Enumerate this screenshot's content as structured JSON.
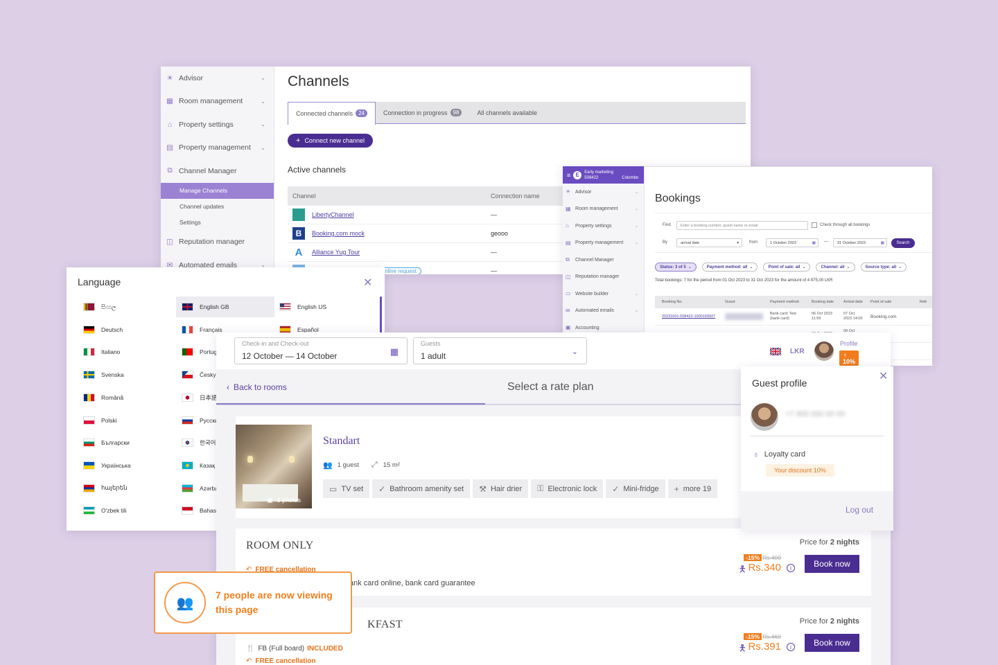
{
  "channels": {
    "title": "Channels",
    "sidebar": [
      {
        "label": "Advisor",
        "icon": "bulb-icon"
      },
      {
        "label": "Room management",
        "icon": "calendar-icon"
      },
      {
        "label": "Property settings",
        "icon": "home-icon"
      },
      {
        "label": "Property management",
        "icon": "clipboard-icon"
      },
      {
        "label": "Channel Manager",
        "icon": "hierarchy-icon"
      }
    ],
    "sidebar_sub": [
      "Manage Channels",
      "Channel updates",
      "Settings"
    ],
    "sidebar_tail": [
      {
        "label": "Reputation manager",
        "icon": "chat-icon"
      },
      {
        "label": "Automated emails",
        "icon": "mail-icon"
      }
    ],
    "tabs": [
      {
        "label": "Connected channels",
        "count": "24"
      },
      {
        "label": "Connection in progress",
        "count": "98"
      },
      {
        "label": "All channels available",
        "count": ""
      }
    ],
    "connect_btn": "Connect new channel",
    "active_title": "Active channels",
    "table_headers": [
      "Channel",
      "Connection name"
    ],
    "rows": [
      {
        "name": "LibertyChannel",
        "conn": "—",
        "logo_color": "#2a9d8f",
        "logo_text": ""
      },
      {
        "name": "Booking.com mock",
        "conn": "gеооо",
        "logo_color": "#1f3f8c",
        "logo_text": "B"
      },
      {
        "name": "Alliance Yug Tour",
        "conn": "—",
        "logo_color": "#ffffff",
        "logo_text": "A"
      },
      {
        "name": "",
        "conn": "—",
        "badge": "Online request",
        "logo_color": "#ffffff",
        "logo_text": ""
      },
      {
        "name": "",
        "conn": "—",
        "logo_color": "#ffffff",
        "logo_text": ""
      },
      {
        "name": "",
        "conn": "—",
        "logo_color": "#ffffff",
        "logo_text": ""
      }
    ]
  },
  "bookings": {
    "title": "Bookings",
    "top_label": "Early marketing",
    "top_sub": "508422",
    "top_city": "Colombo",
    "sidebar": [
      {
        "label": "Advisor",
        "icon": "bulb-icon"
      },
      {
        "label": "Room management",
        "icon": "calendar-icon"
      },
      {
        "label": "Property settings",
        "icon": "home-icon"
      },
      {
        "label": "Property management",
        "icon": "clipboard-icon"
      },
      {
        "label": "Channel Manager",
        "icon": "hierarchy-icon"
      },
      {
        "label": "Reputation manager",
        "icon": "chat-icon"
      },
      {
        "label": "Website builder",
        "icon": "monitor-icon"
      },
      {
        "label": "Automated emails",
        "icon": "mail-icon"
      },
      {
        "label": "Accounting",
        "icon": "wallet-icon"
      }
    ],
    "find_label": "Find",
    "find_placeholder": "Enter a booking number, guest name or email",
    "check_all": "Check through all bookings",
    "by_label": "By",
    "by_value": "arrival date",
    "from_label": "from",
    "from_date": "1 October 2023",
    "to_date": "31 October 2023",
    "search_btn": "Search",
    "chips": [
      {
        "label": "Status: 3 of 5"
      },
      {
        "label": "Payment method: all"
      },
      {
        "label": "Point of sale: all"
      },
      {
        "label": "Channel: all"
      },
      {
        "label": "Source type: all"
      }
    ],
    "total_text": "Total bookings: 7 for the period from 01 Oct 2023 to 31 Oct 2023 for the amount of 4 875,00 LKR",
    "table_headers": [
      "Booking No.",
      "Guest",
      "Payment method",
      "Booking date",
      "Arrival date",
      "Point of sale",
      "Refe"
    ],
    "rows": [
      {
        "no": "20231001-508422-1000169927",
        "guest": "",
        "payment": "Bank card: Test (bank card)",
        "bdate": "06 Oct 2023 11:59",
        "adate": "07 Oct 2023 14:00",
        "pos": "Booking.com"
      },
      {
        "no": "",
        "guest": "",
        "payment": "",
        "bdate": "09 Oct 2023",
        "adate": "09 Oct 2023",
        "pos": "g.com"
      },
      {
        "no": "",
        "guest": "",
        "payment": "",
        "bdate": "",
        "adate": "",
        "pos": "g.com"
      }
    ]
  },
  "language": {
    "title": "Language",
    "col1": [
      {
        "label": "සිංහල",
        "flag": "lk"
      },
      {
        "label": "Deutsch",
        "flag": "de"
      },
      {
        "label": "Italiano",
        "flag": "it"
      },
      {
        "label": "Svenska",
        "flag": "se"
      },
      {
        "label": "Română",
        "flag": "ro"
      },
      {
        "label": "Polski",
        "flag": "pl"
      },
      {
        "label": "Български",
        "flag": "bg"
      },
      {
        "label": "Українська",
        "flag": "ua"
      },
      {
        "label": "հայերեն",
        "flag": "am"
      },
      {
        "label": "O'zbek tili",
        "flag": "uz"
      }
    ],
    "col2": [
      {
        "label": "English GB",
        "flag": "gb"
      },
      {
        "label": "Français",
        "flag": "fr"
      },
      {
        "label": "Portug",
        "flag": "pt"
      },
      {
        "label": "Česky",
        "flag": "cz"
      },
      {
        "label": "日本語",
        "flag": "jp"
      },
      {
        "label": "Русски",
        "flag": "ru"
      },
      {
        "label": "한국어",
        "flag": "kr"
      },
      {
        "label": "Казақ",
        "flag": "kz"
      },
      {
        "label": "Azərba",
        "flag": "az"
      },
      {
        "label": "Bahasa",
        "flag": "id"
      }
    ],
    "col3": [
      {
        "label": "English US",
        "flag": "us"
      },
      {
        "label": "Español",
        "flag": "es"
      }
    ]
  },
  "engine": {
    "dates_label": "Check-in and Check-out",
    "dates_value": "12 October — 14 October",
    "guests_label": "Guests",
    "guests_value": "1 adult",
    "currency": "LKR",
    "profile_label": "Profile",
    "profile_discount": "10%",
    "back_label": "Back to rooms",
    "step_title": "Select a rate plan",
    "room": {
      "name": "Standart",
      "photos": "3 photos",
      "guests": "1 guest",
      "area": "15 m²",
      "amenities": [
        {
          "label": "TV set",
          "icon": "tv-icon"
        },
        {
          "label": "Bathroom amenity set",
          "icon": "check-circle-icon"
        },
        {
          "label": "Hair drier",
          "icon": "hairdryer-icon"
        },
        {
          "label": "Electronic lock",
          "icon": "key-icon"
        },
        {
          "label": "Mini-fridge",
          "icon": "check-circle-icon"
        },
        {
          "label": "more 19",
          "icon": "plus-icon"
        }
      ]
    },
    "plans": [
      {
        "name": "ROOM ONLY",
        "price_for": "Price for",
        "nights": "2 nights",
        "discount": "-15%",
        "old_price": "Rs.400",
        "new_price": "Rs.340",
        "book": "Book now",
        "line1_text": "FREE cancellation",
        "line2_text": "ank card online, bank card guarantee"
      },
      {
        "name": "KFAST",
        "price_for": "Price for",
        "nights": "2 nights",
        "discount": "-15%",
        "old_price": "Rs.460",
        "new_price": "Rs.391",
        "book": "Book now",
        "line1_text": "FB (Full board)",
        "line1_suffix": "INCLUDED",
        "line2_text": "FREE cancellation"
      }
    ]
  },
  "guest_profile": {
    "title": "Guest profile",
    "phone": "+7 900 000 00 00",
    "loyalty": "Loyalty card",
    "discount": "Your discount 10%",
    "logout": "Log out"
  },
  "viewing": {
    "text": "7 people are now viewing this page"
  },
  "colors": {
    "brand": "#4a2d91",
    "accent": "#8a7cc8",
    "orange": "#f07e1e",
    "background": "#dccfe6"
  }
}
